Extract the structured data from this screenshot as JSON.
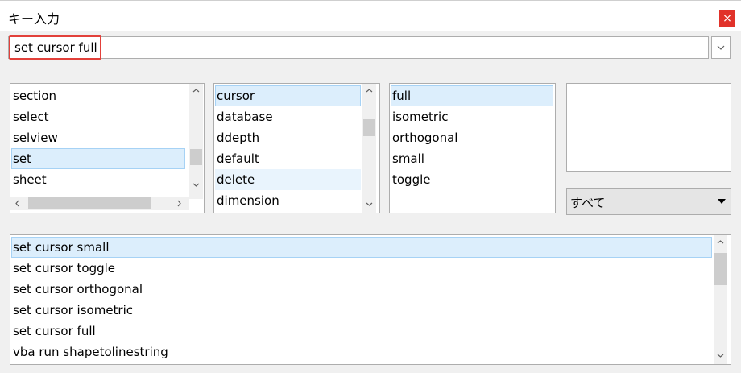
{
  "window": {
    "title": "キー入力",
    "close_glyph": "×"
  },
  "command_input": {
    "value": "set cursor full"
  },
  "list1": {
    "items": [
      "section",
      "select",
      "selview",
      "set",
      "sheet"
    ],
    "selected": "set"
  },
  "list2": {
    "items": [
      "cursor",
      "database",
      "ddepth",
      "default",
      "delete",
      "dimension"
    ],
    "selected": "cursor"
  },
  "list3": {
    "items": [
      "full",
      "isometric",
      "orthogonal",
      "small",
      "toggle"
    ],
    "selected": "full"
  },
  "filter": {
    "label": "すべて"
  },
  "history": {
    "items": [
      "set cursor small",
      "set cursor toggle",
      "set cursor orthogonal",
      "set cursor isometric",
      "set cursor full",
      "vba run shapetolinestring"
    ],
    "selected": "set cursor small"
  },
  "colors": {
    "selection_bg": "#dceefc",
    "selection_border": "#a6d2f5",
    "highlight_red": "#e2403a",
    "close_red": "#e1322a"
  }
}
